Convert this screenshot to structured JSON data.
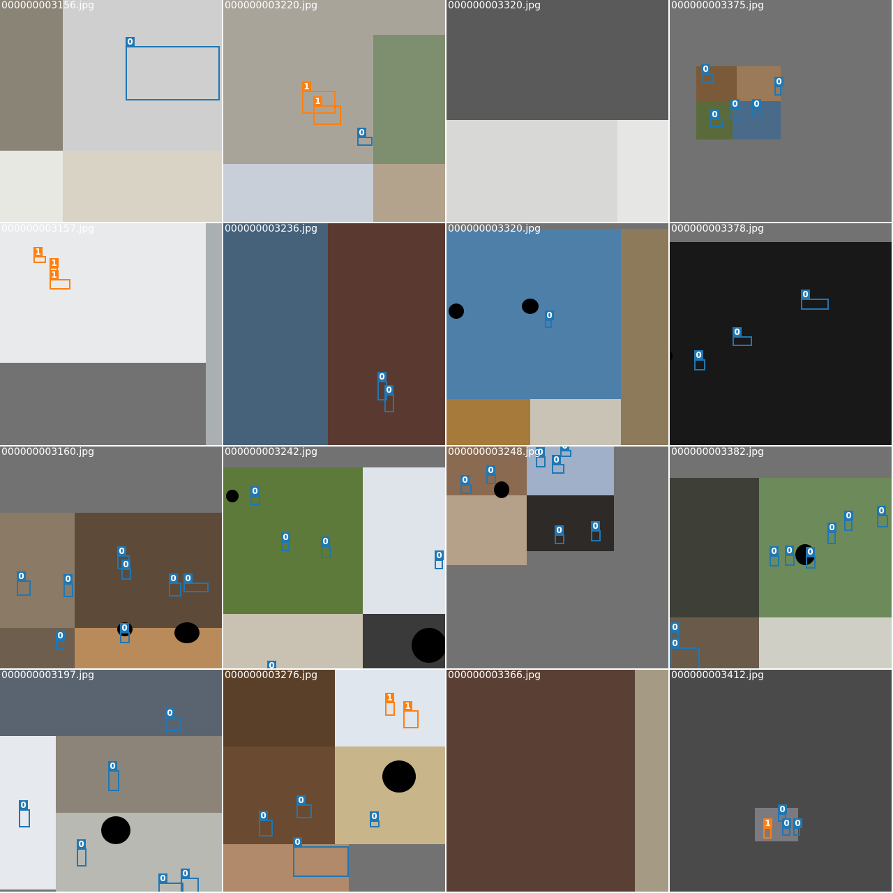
{
  "grid_title": "",
  "colors": {
    "class_0": "#1f77b4",
    "class_1": "#ff7f0e",
    "pad": "#727272",
    "label_text": "#ffffff"
  },
  "tiles": [
    {
      "filename": "000000003156.jpg",
      "photos": [
        {
          "c": "#8a8476"
        },
        {
          "c": "#cfcfcf"
        },
        {
          "c": "#e8e8e2"
        },
        {
          "c": "#d9d3c5"
        }
      ],
      "boxes": [
        {
          "cls": "0"
        }
      ]
    },
    {
      "filename": "000000003220.jpg",
      "photos": [
        {
          "c": "#a9a49a"
        },
        {
          "c": "#7d8f6e"
        },
        {
          "c": "#c9cfd8"
        },
        {
          "c": "#b4a38c"
        }
      ],
      "boxes": [
        {
          "cls": "1"
        },
        {
          "cls": "1"
        },
        {
          "cls": "0"
        }
      ]
    },
    {
      "filename": "000000003320.jpg",
      "photos": [
        {
          "c": "#5a5a5a"
        },
        {
          "c": "#d8d8d6"
        },
        {
          "c": "#e6e6e4"
        }
      ],
      "boxes": []
    },
    {
      "filename": "000000003375.jpg",
      "photos": [
        {
          "c": "#7a5a38"
        },
        {
          "c": "#9a7a58"
        },
        {
          "c": "#5a6a3a"
        },
        {
          "c": "#4a6a8a"
        }
      ],
      "boxes": [
        {
          "cls": "0"
        },
        {
          "cls": "0"
        },
        {
          "cls": "0"
        },
        {
          "cls": "0"
        },
        {
          "cls": "0"
        }
      ]
    },
    {
      "filename": "000000003157.jpg",
      "photos": [
        {
          "c": "#e9eaec"
        },
        {
          "c": "#aab0b2"
        }
      ],
      "boxes": [
        {
          "cls": "1"
        },
        {
          "cls": "1"
        },
        {
          "cls": "1"
        }
      ]
    },
    {
      "filename": "000000003236.jpg",
      "photos": [
        {
          "c": "#46617a"
        },
        {
          "c": "#5a3a30"
        }
      ],
      "boxes": [
        {
          "cls": "0"
        },
        {
          "cls": "0"
        }
      ]
    },
    {
      "filename": "000000003320.jpg",
      "photos": [
        {
          "c": "#4d7fa9"
        },
        {
          "c": "#a57a3a"
        },
        {
          "c": "#c9c3b5"
        },
        {
          "c": "#8d7a5a"
        }
      ],
      "boxes": [
        {
          "cls": "0"
        }
      ]
    },
    {
      "filename": "000000003378.jpg",
      "photos": [
        {
          "c": "#181818"
        }
      ],
      "boxes": [
        {
          "cls": "0"
        },
        {
          "cls": "0"
        },
        {
          "cls": "0"
        }
      ]
    },
    {
      "filename": "000000003160.jpg",
      "photos": [
        {
          "c": "#8a7a66"
        },
        {
          "c": "#5e4a38"
        },
        {
          "c": "#6e5e4e"
        },
        {
          "c": "#b98a5a"
        }
      ],
      "boxes": [
        {
          "cls": "0"
        },
        {
          "cls": "0"
        },
        {
          "cls": "0"
        },
        {
          "cls": "0"
        },
        {
          "cls": "0"
        },
        {
          "cls": "0"
        },
        {
          "cls": "0"
        },
        {
          "cls": "0"
        }
      ]
    },
    {
      "filename": "000000003242.jpg",
      "photos": [
        {
          "c": "#5d7a3a"
        },
        {
          "c": "#dfe4ea"
        },
        {
          "c": "#c9c1b1"
        },
        {
          "c": "#3a3a3a"
        }
      ],
      "boxes": [
        {
          "cls": "0"
        },
        {
          "cls": "0"
        },
        {
          "cls": "0"
        },
        {
          "cls": "0"
        },
        {
          "cls": "0"
        }
      ]
    },
    {
      "filename": "000000003248.jpg",
      "photos": [
        {
          "c": "#8a6a50"
        },
        {
          "c": "#9fb0c8"
        },
        {
          "c": "#b5a08a"
        },
        {
          "c": "#2e2a28"
        }
      ],
      "boxes": [
        {
          "cls": "0"
        },
        {
          "cls": "0"
        },
        {
          "cls": "0"
        },
        {
          "cls": "0"
        },
        {
          "cls": "0"
        },
        {
          "cls": "0"
        },
        {
          "cls": "0"
        }
      ]
    },
    {
      "filename": "000000003382.jpg",
      "photos": [
        {
          "c": "#3e4038"
        },
        {
          "c": "#6d8a5a"
        },
        {
          "c": "#6a5a4a"
        },
        {
          "c": "#cfcfc6"
        }
      ],
      "boxes": [
        {
          "cls": "0"
        },
        {
          "cls": "0"
        },
        {
          "cls": "0"
        },
        {
          "cls": "0"
        },
        {
          "cls": "0"
        },
        {
          "cls": "0"
        },
        {
          "cls": "0"
        },
        {
          "cls": "0"
        }
      ]
    },
    {
      "filename": "000000003197.jpg",
      "photos": [
        {
          "c": "#5a6470"
        },
        {
          "c": "#e6e9ed"
        },
        {
          "c": "#8c8479"
        },
        {
          "c": "#b9b9b3"
        }
      ],
      "boxes": [
        {
          "cls": "0"
        },
        {
          "cls": "0"
        },
        {
          "cls": "0"
        },
        {
          "cls": "0"
        },
        {
          "cls": "0"
        },
        {
          "cls": "0"
        }
      ]
    },
    {
      "filename": "000000003276.jpg",
      "photos": [
        {
          "c": "#5a4028"
        },
        {
          "c": "#dfe6ee"
        },
        {
          "c": "#6a4a30"
        },
        {
          "c": "#c9b58a"
        },
        {
          "c": "#b08a6a"
        }
      ],
      "boxes": [
        {
          "cls": "1"
        },
        {
          "cls": "1"
        },
        {
          "cls": "0"
        },
        {
          "cls": "0"
        },
        {
          "cls": "0"
        },
        {
          "cls": "0"
        }
      ]
    },
    {
      "filename": "000000003366.jpg",
      "photos": [
        {
          "c": "#5a4034"
        },
        {
          "c": "#a59a84"
        }
      ],
      "boxes": []
    },
    {
      "filename": "000000003412.jpg",
      "photos": [
        {
          "c": "#4a4a4a"
        },
        {
          "c": "#7a7a80"
        }
      ],
      "boxes": [
        {
          "cls": "0"
        },
        {
          "cls": "1"
        },
        {
          "cls": "0"
        },
        {
          "cls": "0"
        }
      ]
    }
  ]
}
